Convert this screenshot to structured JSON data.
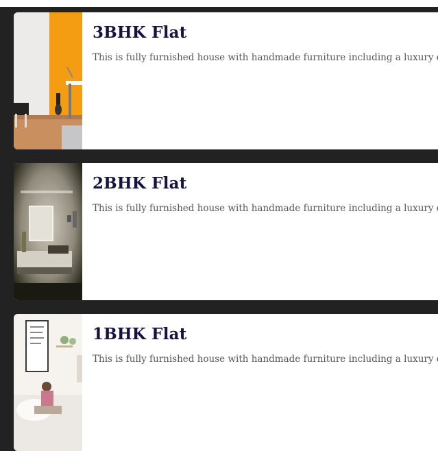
{
  "listings": [
    {
      "title": "3BHK Flat",
      "description": "This is fully furnished house with handmade furniture including a luxury e",
      "image": "living-room-photo"
    },
    {
      "title": "2BHK Flat",
      "description": "This is fully furnished house with handmade furniture including a luxury e",
      "image": "bedroom-photo"
    },
    {
      "title": "1BHK Flat",
      "description": "This is fully furnished house with handmade furniture including a luxury e",
      "image": "couch-photo"
    }
  ],
  "colors": {
    "background": "#222222",
    "card": "#ffffff",
    "title": "#14123f",
    "description": "#55555f"
  }
}
